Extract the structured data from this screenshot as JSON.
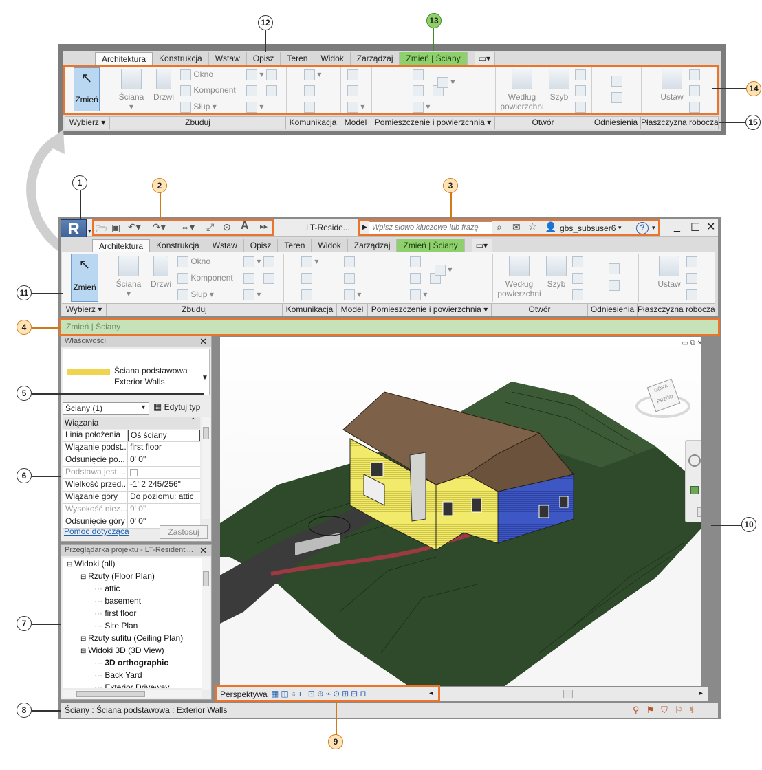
{
  "ribbon": {
    "tabs": [
      "Architektura",
      "Konstrukcja",
      "Wstaw",
      "Opisz",
      "Teren",
      "Widok",
      "Zarządzaj",
      "Zmień | Ściany"
    ],
    "mini_tab_glyph": "▭▾",
    "modify_label": "Zmień",
    "build_buttons": {
      "wall": "Ściana",
      "door": "Drzwi",
      "window": "Okno",
      "component": "Komponent",
      "column": "Słup"
    },
    "opening_buttons": {
      "by_face": "Według powierzchni",
      "shaft": "Szyb"
    },
    "workplane_button": "Ustaw",
    "panels": [
      "Wybierz ▾",
      "Zbuduj",
      "Komunikacja",
      "Model",
      "Pomieszczenie i powierzchnia ▾",
      "Otwór",
      "Odniesienia",
      "Płaszczyzna robocza"
    ]
  },
  "app": {
    "logo_letter": "R",
    "logo_sub": "LT",
    "doc_title": "LT-Reside...",
    "search_placeholder": "Wpisz słowo kluczowe lub frazę",
    "user": "gbs_subsuser6",
    "help": "?"
  },
  "options_bar": {
    "text": "Zmień | Ściany"
  },
  "properties": {
    "title": "Właściwości",
    "type_line1": "Ściana podstawowa",
    "type_line2": "Exterior Walls",
    "selector": "Ściany (1)",
    "edit_type": "Edytuj typ",
    "group": "Wiązania",
    "rows": [
      {
        "k": "Linia położenia",
        "v": "Oś ściany",
        "dim": false
      },
      {
        "k": "Wiązanie podst...",
        "v": "first floor",
        "dim": false
      },
      {
        "k": "Odsunięcie po...",
        "v": "0'  0\"",
        "dim": false
      },
      {
        "k": "Podstawa jest ...",
        "v": "",
        "dim": true
      },
      {
        "k": "Wielkość przed...",
        "v": "-1'  2 245/256\"",
        "dim": false
      },
      {
        "k": "Wiązanie góry",
        "v": "Do poziomu: attic",
        "dim": false
      },
      {
        "k": "Wysokość niez...",
        "v": "9'  0\"",
        "dim": true
      },
      {
        "k": "Odsunięcie góry",
        "v": "0'  0\"",
        "dim": false
      }
    ],
    "help_link": "Pomoc dotycząca",
    "apply": "Zastosuj"
  },
  "browser": {
    "title": "Przeglądarka projektu - LT-Residenti...",
    "items": [
      {
        "label": "Widoki (all)",
        "indent": 0,
        "bold": false
      },
      {
        "label": "Rzuty (Floor Plan)",
        "indent": 1,
        "bold": false
      },
      {
        "label": "attic",
        "indent": 2,
        "bold": false
      },
      {
        "label": "basement",
        "indent": 2,
        "bold": false
      },
      {
        "label": "first floor",
        "indent": 2,
        "bold": false
      },
      {
        "label": "Site Plan",
        "indent": 2,
        "bold": false
      },
      {
        "label": "Rzuty sufitu (Ceiling Plan)",
        "indent": 1,
        "bold": false
      },
      {
        "label": "Widoki 3D (3D View)",
        "indent": 1,
        "bold": false
      },
      {
        "label": "3D orthographic",
        "indent": 2,
        "bold": true
      },
      {
        "label": "Back Yard",
        "indent": 2,
        "bold": false
      },
      {
        "label": "Exterior Driveway",
        "indent": 2,
        "bold": false
      }
    ]
  },
  "viewbar": {
    "label": "Perspektywa"
  },
  "status": {
    "text": "Ściany : Ściana podstawowa : Exterior Walls"
  },
  "viewcube": {
    "front": "PRZÓD",
    "top": "GÓRA"
  },
  "callouts": [
    "1",
    "2",
    "3",
    "4",
    "5",
    "6",
    "7",
    "8",
    "9",
    "10",
    "11",
    "12",
    "13",
    "14",
    "15"
  ]
}
